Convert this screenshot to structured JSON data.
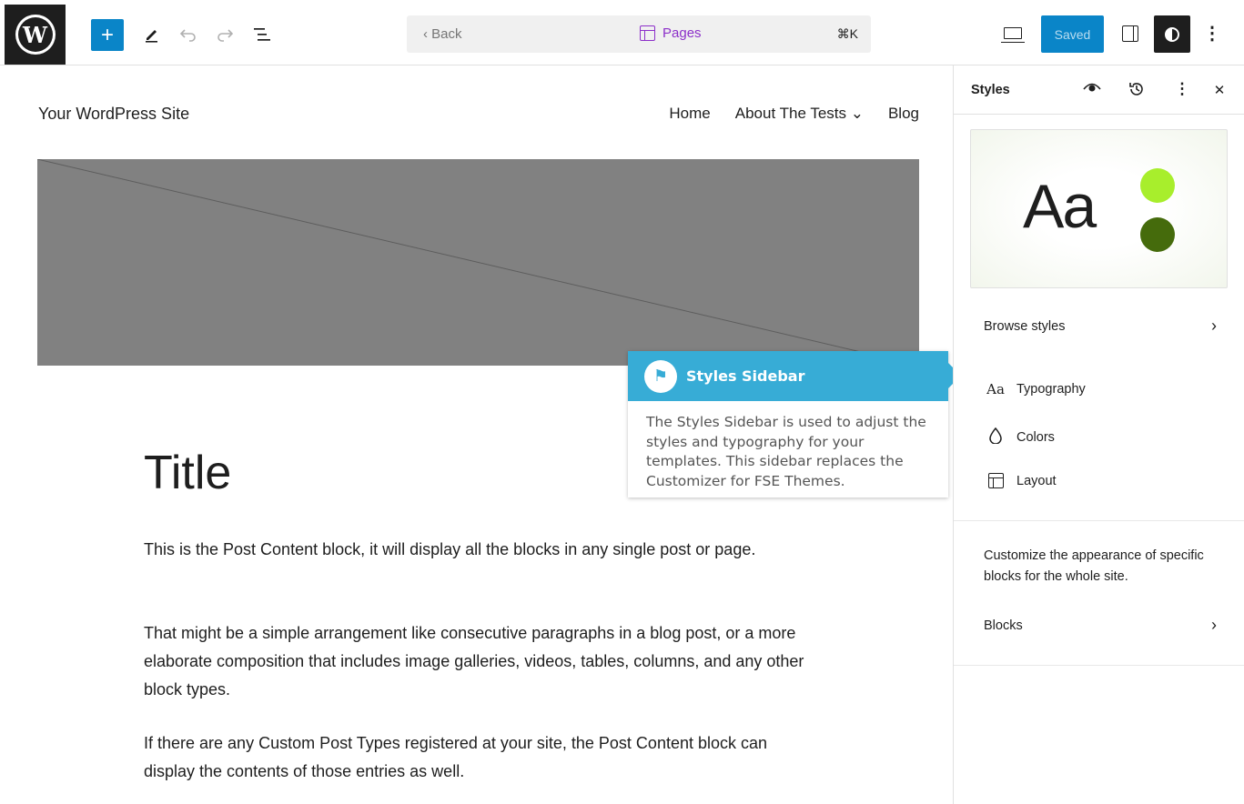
{
  "toolbar": {
    "logo_letter": "W",
    "add_label": "+",
    "back_label": "‹  Back",
    "command_center_label": "Pages",
    "shortcut": "⌘K",
    "saved_label": "Saved",
    "more_label": "⋮"
  },
  "canvas": {
    "site_title": "Your WordPress Site",
    "nav": [
      "Home",
      "About The Tests ⌄",
      "Blog"
    ],
    "post_title": "Title",
    "paragraphs": [
      "This is the Post Content block, it will display all the blocks in any single post or page.",
      "That might be a simple arrangement like consecutive paragraphs in a blog post, or a more elaborate composition that includes image galleries, videos, tables, columns, and any other block types.",
      "If there are any Custom Post Types registered at your site, the Post Content block can display the contents of those entries as well."
    ]
  },
  "tour": {
    "title": "Styles Sidebar",
    "body": "The Styles  Sidebar is used to adjust the styles and typography for your templates. This sidebar replaces the Customizer for FSE Themes."
  },
  "sidebar": {
    "title": "Styles",
    "preview_text": "Aa",
    "preview_colors": [
      "#a8ee2c",
      "#456b0c"
    ],
    "browse_styles": "Browse styles",
    "items": [
      {
        "icon": "Aa",
        "label": "Typography"
      },
      {
        "icon": "droplet",
        "label": "Colors"
      },
      {
        "icon": "layout",
        "label": "Layout"
      }
    ],
    "blocks_description": "Customize the appearance of specific blocks for the whole site.",
    "blocks_label": "Blocks",
    "chevron": "›",
    "close": "✕"
  },
  "colors": {
    "accent": "#0a85c8",
    "tour": "#37acd6",
    "command_center": "#8c2fc9",
    "hero": "#818181"
  }
}
